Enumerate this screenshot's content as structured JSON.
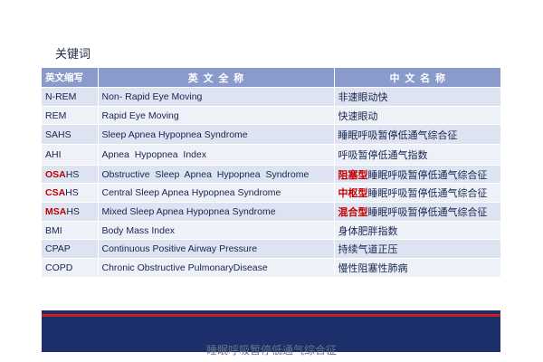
{
  "title": "关键词",
  "table": {
    "headers": [
      "英文缩写",
      "英 文 全 称",
      "中 文 名 称"
    ],
    "rows": [
      {
        "abbr_hl": "",
        "abbr": "N-REM",
        "en": "Non- Rapid Eye Moving",
        "cn_hl": "",
        "cn": "非速眼动快"
      },
      {
        "abbr_hl": "",
        "abbr": "REM",
        "en": "Rapid Eye Moving",
        "cn_hl": "",
        "cn": "快速眼动"
      },
      {
        "abbr_hl": "",
        "abbr": "SAHS",
        "en": "Sleep Apnea Hypopnea Syndrome",
        "cn_hl": "",
        "cn": "睡眠呼吸暂停低通气综合征"
      },
      {
        "abbr_hl": "",
        "abbr": "AHI",
        "en": "Apnea  Hypopnea  Index",
        "cn_hl": "",
        "cn": "呼吸暂停低通气指数"
      },
      {
        "abbr_hl": "OSA",
        "abbr": "HS",
        "en": "Obstructive  Sleep  Apnea  Hypopnea  Syndrome",
        "cn_hl": "阻塞型",
        "cn": "睡眠呼吸暂停低通气综合征"
      },
      {
        "abbr_hl": "CSA",
        "abbr": "HS",
        "en": "Central Sleep Apnea Hypopnea Syndrome",
        "cn_hl": "中枢型",
        "cn": "睡眠呼吸暂停低通气综合征"
      },
      {
        "abbr_hl": "MSA",
        "abbr": "HS",
        "en": "Mixed Sleep Apnea Hypopnea Syndrome",
        "cn_hl": "混合型",
        "cn": "睡眠呼吸暂停低通气综合征"
      },
      {
        "abbr_hl": "",
        "abbr": "BMI",
        "en": "Body Mass Index",
        "cn_hl": "",
        "cn": "身体肥胖指数"
      },
      {
        "abbr_hl": "",
        "abbr": "CPAP",
        "en": "Continuous Positive Airway Pressure",
        "cn_hl": "",
        "cn": "持续气道正压"
      },
      {
        "abbr_hl": "",
        "abbr": "COPD",
        "en": "Chronic Obstructive PulmonaryDisease",
        "cn_hl": "",
        "cn": "慢性阻塞性肺病"
      }
    ]
  },
  "footer": "睡眠呼吸暂停低通气综合征",
  "colors": {
    "header_bg": "#8a9acb",
    "row_odd": "#dde3f1",
    "row_even": "#eef1f8",
    "text": "#17254f",
    "highlight": "#c00000",
    "bar_navy": "#1d2f6b",
    "bar_red": "#c81f20"
  }
}
